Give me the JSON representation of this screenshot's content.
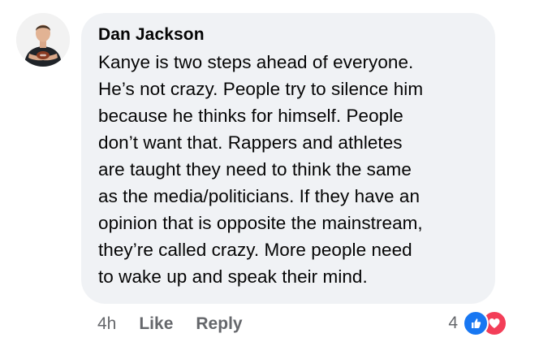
{
  "comment": {
    "author": "Dan Jackson",
    "text_lines": [
      "Kanye is two steps ahead of everyone.",
      "He’s not crazy. People try to silence him",
      "because he thinks for himself. People",
      "don’t want that. Rappers and athletes",
      "are taught they need to think the same",
      "as the media/politicians. If they have an",
      "opinion that is opposite the mainstream,",
      "they’re called crazy. More people need",
      "to wake up and speak their mind."
    ]
  },
  "actions": {
    "time": "4h",
    "like_label": "Like",
    "reply_label": "Reply"
  },
  "reactions": {
    "count": "4",
    "types": [
      "like-icon",
      "love-icon"
    ]
  },
  "colors": {
    "bubble_bg": "#f0f2f5",
    "meta_text": "#65676b",
    "like_blue": "#1877f2",
    "love_red": "#f33e58"
  }
}
